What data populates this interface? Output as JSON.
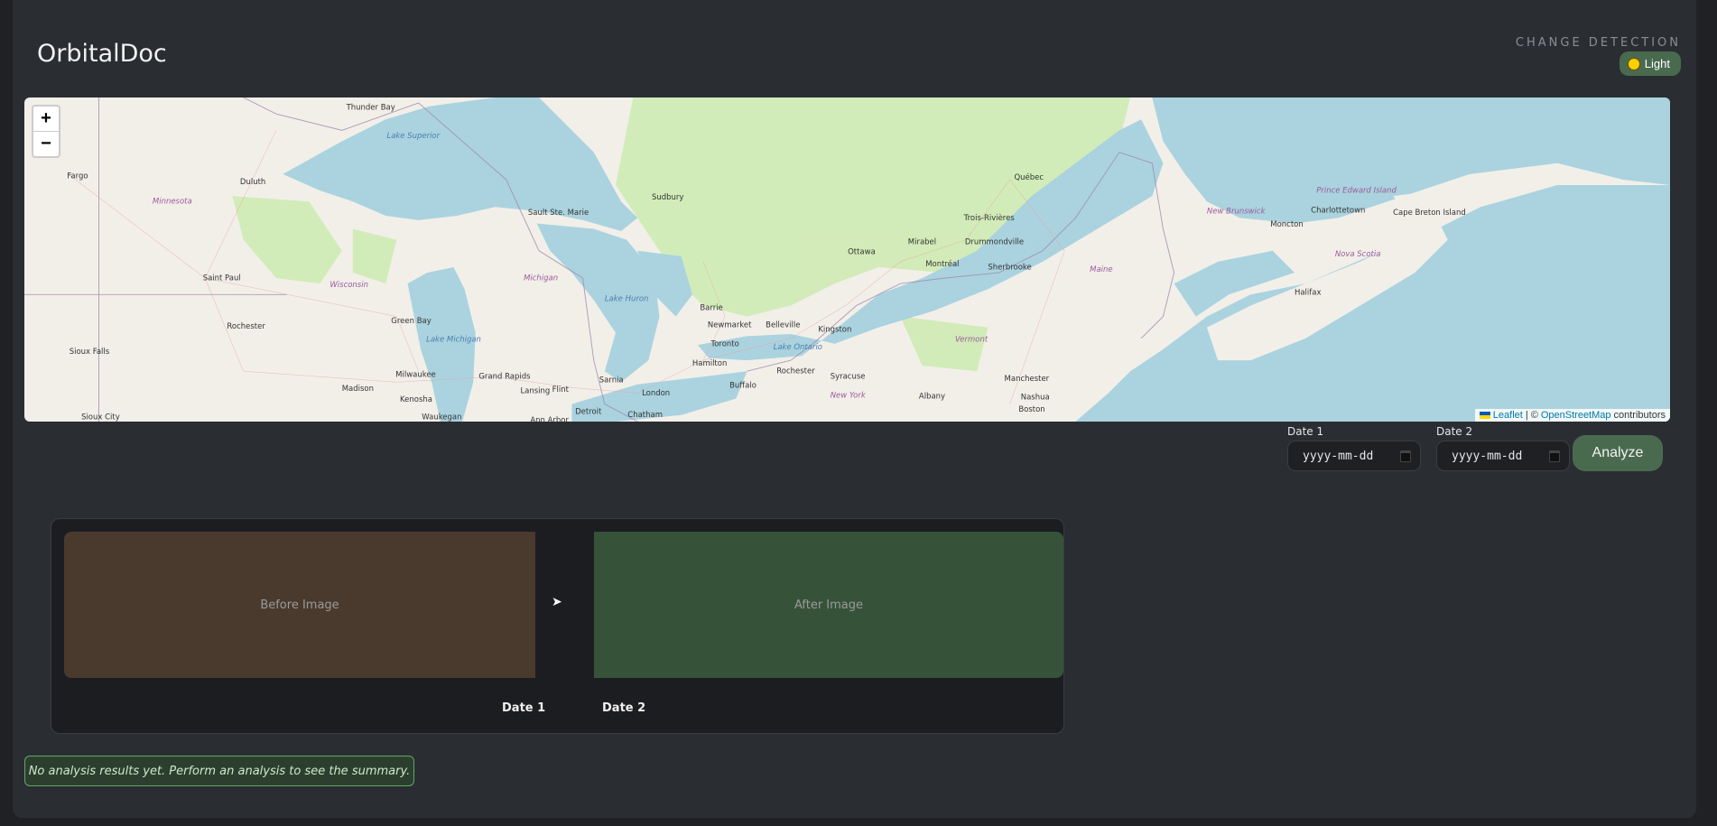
{
  "header": {
    "title": "OrbitalDoc",
    "subtitle": "CHANGE DETECTION",
    "theme_button": "Light",
    "theme_icon": "sun-icon"
  },
  "map": {
    "zoom_in": "+",
    "zoom_out": "−",
    "attribution": {
      "leaflet": "Leaflet",
      "separator": "| ©",
      "osm": "OpenStreetMap",
      "suffix": "contributors"
    },
    "labels": [
      {
        "text": "Thunder Bay",
        "kind": "city"
      },
      {
        "text": "Lake Superior",
        "kind": "water"
      },
      {
        "text": "Fargo",
        "kind": "city"
      },
      {
        "text": "Duluth",
        "kind": "city"
      },
      {
        "text": "Minnesota",
        "kind": "state"
      },
      {
        "text": "Sault Ste. Marie",
        "kind": "city"
      },
      {
        "text": "Sudbury",
        "kind": "city"
      },
      {
        "text": "Québec",
        "kind": "city"
      },
      {
        "text": "Trois-Rivières",
        "kind": "city"
      },
      {
        "text": "Mirabel",
        "kind": "city"
      },
      {
        "text": "Drummondville",
        "kind": "city"
      },
      {
        "text": "Ottawa",
        "kind": "city"
      },
      {
        "text": "Montréal",
        "kind": "city"
      },
      {
        "text": "Sherbrooke",
        "kind": "city"
      },
      {
        "text": "Saint Paul",
        "kind": "city"
      },
      {
        "text": "Wisconsin",
        "kind": "state"
      },
      {
        "text": "Michigan",
        "kind": "state"
      },
      {
        "text": "Lake Huron",
        "kind": "water"
      },
      {
        "text": "Maine",
        "kind": "state"
      },
      {
        "text": "New Brunswick",
        "kind": "state"
      },
      {
        "text": "Prince Edward Island",
        "kind": "state"
      },
      {
        "text": "Charlottetown",
        "kind": "city"
      },
      {
        "text": "Cape Breton Island",
        "kind": "city"
      },
      {
        "text": "Moncton",
        "kind": "city"
      },
      {
        "text": "Nova Scotia",
        "kind": "state"
      },
      {
        "text": "Halifax",
        "kind": "city"
      },
      {
        "text": "Barrie",
        "kind": "city"
      },
      {
        "text": "Newmarket",
        "kind": "city"
      },
      {
        "text": "Belleville",
        "kind": "city"
      },
      {
        "text": "Kingston",
        "kind": "city"
      },
      {
        "text": "Green Bay",
        "kind": "city"
      },
      {
        "text": "Rochester",
        "kind": "city"
      },
      {
        "text": "Lake Michigan",
        "kind": "water"
      },
      {
        "text": "Toronto",
        "kind": "city"
      },
      {
        "text": "Lake Ontario",
        "kind": "water"
      },
      {
        "text": "Vermont",
        "kind": "state"
      },
      {
        "text": "Sioux Falls",
        "kind": "city"
      },
      {
        "text": "Hamilton",
        "kind": "city"
      },
      {
        "text": "Rochester",
        "kind": "city"
      },
      {
        "text": "Syracuse",
        "kind": "city"
      },
      {
        "text": "Grand Rapids",
        "kind": "city"
      },
      {
        "text": "Manchester",
        "kind": "city"
      },
      {
        "text": "Milwaukee",
        "kind": "city"
      },
      {
        "text": "Madison",
        "kind": "city"
      },
      {
        "text": "Sarnia",
        "kind": "city"
      },
      {
        "text": "Lansing",
        "kind": "city"
      },
      {
        "text": "Flint",
        "kind": "city"
      },
      {
        "text": "London",
        "kind": "city"
      },
      {
        "text": "Buffalo",
        "kind": "city"
      },
      {
        "text": "Kenosha",
        "kind": "city"
      },
      {
        "text": "New York",
        "kind": "state"
      },
      {
        "text": "Albany",
        "kind": "city"
      },
      {
        "text": "Nashua",
        "kind": "city"
      },
      {
        "text": "Boston",
        "kind": "city"
      },
      {
        "text": "Waukegan",
        "kind": "city"
      },
      {
        "text": "Detroit",
        "kind": "city"
      },
      {
        "text": "Chatham",
        "kind": "city"
      },
      {
        "text": "Ann Arbor",
        "kind": "city"
      },
      {
        "text": "Sioux City",
        "kind": "city"
      }
    ]
  },
  "controls": {
    "date1": {
      "label": "Date 1",
      "placeholder": "yyyy-mm-dd"
    },
    "date2": {
      "label": "Date 2",
      "placeholder": "yyyy-mm-dd"
    },
    "analyze": "Analyze"
  },
  "comparison": {
    "before": "Before Image",
    "after": "After Image",
    "arrow": "➤",
    "date1": "Date 1",
    "date2": "Date 2"
  },
  "summary": "No analysis results yet. Perform an analysis to see the summary.",
  "colors": {
    "accent": "#4a6a4f",
    "before": "#4a3a2e",
    "after": "#36533a",
    "summary_border": "#5fa865"
  }
}
